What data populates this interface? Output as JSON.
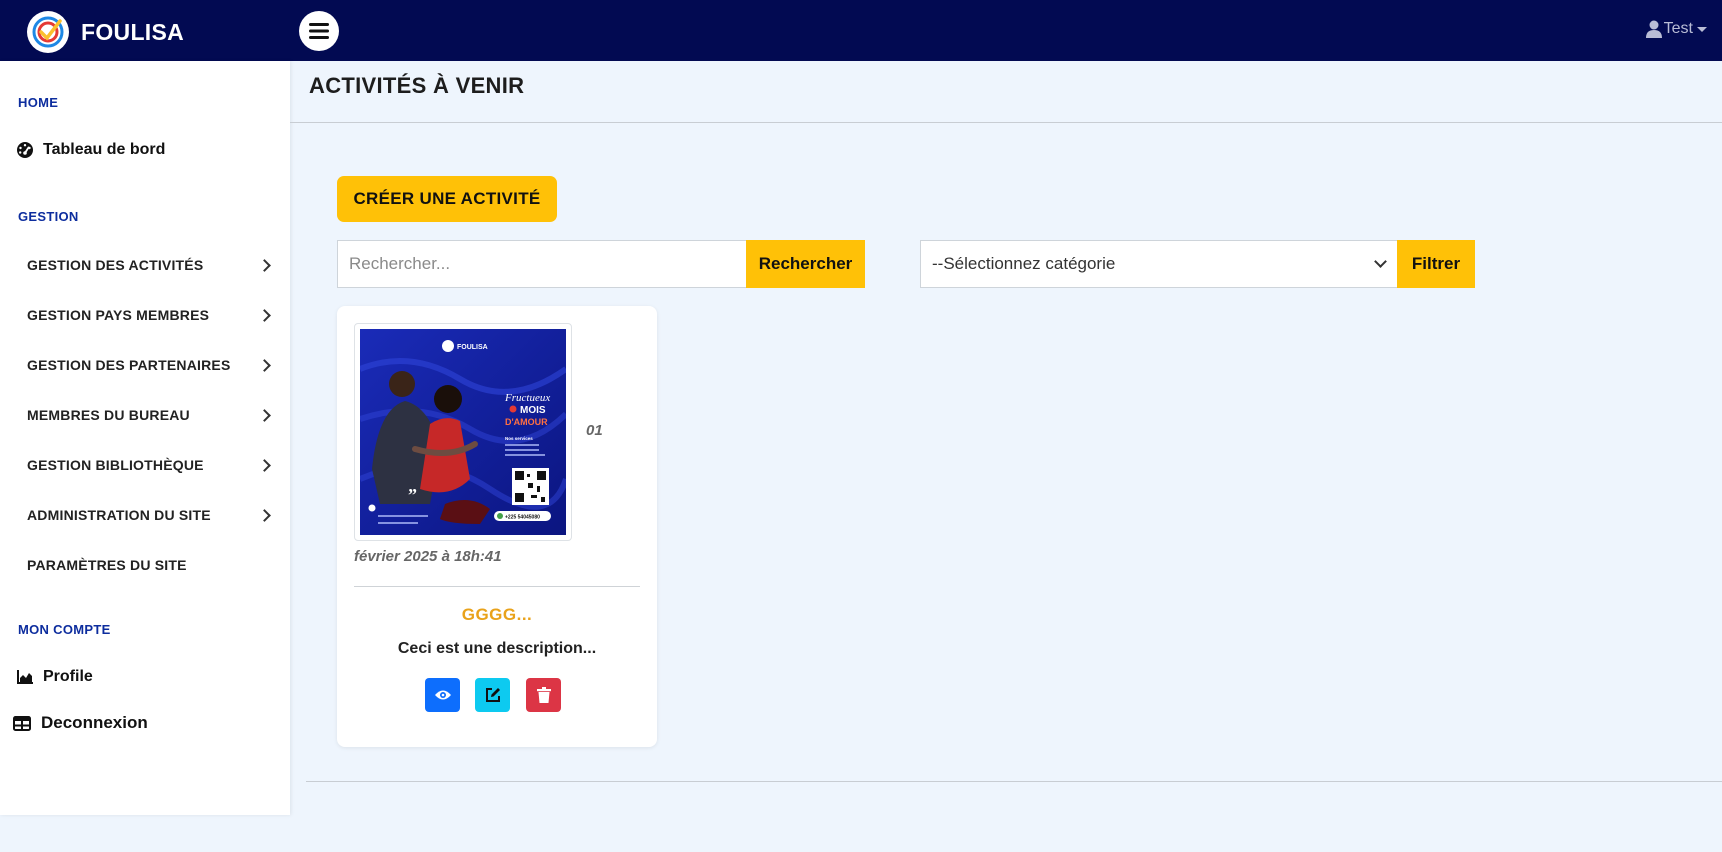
{
  "app": {
    "name": "FOULISA",
    "user": "Test"
  },
  "sidebar": {
    "home_title": "HOME",
    "dashboard_label": "Tableau de bord",
    "gestion_title": "GESTION",
    "items": [
      {
        "label": "GESTION DES ACTIVITÉS"
      },
      {
        "label": "GESTION PAYS MEMBRES"
      },
      {
        "label": "GESTION DES PARTENAIRES"
      },
      {
        "label": "MEMBRES DU BUREAU"
      },
      {
        "label": "GESTION BIBLIOTHÈQUE"
      },
      {
        "label": "ADMINISTRATION DU SITE"
      },
      {
        "label": "PARAMÈTRES DU SITE"
      }
    ],
    "account_title": "MON COMPTE",
    "profile_label": "Profile",
    "logout_label": "Deconnexion"
  },
  "main": {
    "page_title": "ACTIVITÉS À VENIR",
    "create_label": "CRÉER UNE ACTIVITÉ",
    "search": {
      "placeholder": "Rechercher...",
      "button_label": "Rechercher"
    },
    "category": {
      "selected": "--Sélectionnez catégorie",
      "button_label": "Filtrer"
    },
    "card": {
      "date_part1": "01",
      "date_part2": "février 2025 à 18h:41",
      "title": "GGGG...",
      "description": "Ceci est une description...",
      "poster": {
        "brand": "FOULISA",
        "headline_1": "Fructueux",
        "headline_2": "MOIS",
        "headline_3": "D'AMOUR",
        "services_title": "Nos services",
        "phone": "+225 54045080"
      }
    }
  },
  "colors": {
    "navbar": "#020a52",
    "accent": "#ffc107",
    "view": "#0d6efd",
    "edit": "#0dcaf0",
    "delete": "#dc3545"
  }
}
